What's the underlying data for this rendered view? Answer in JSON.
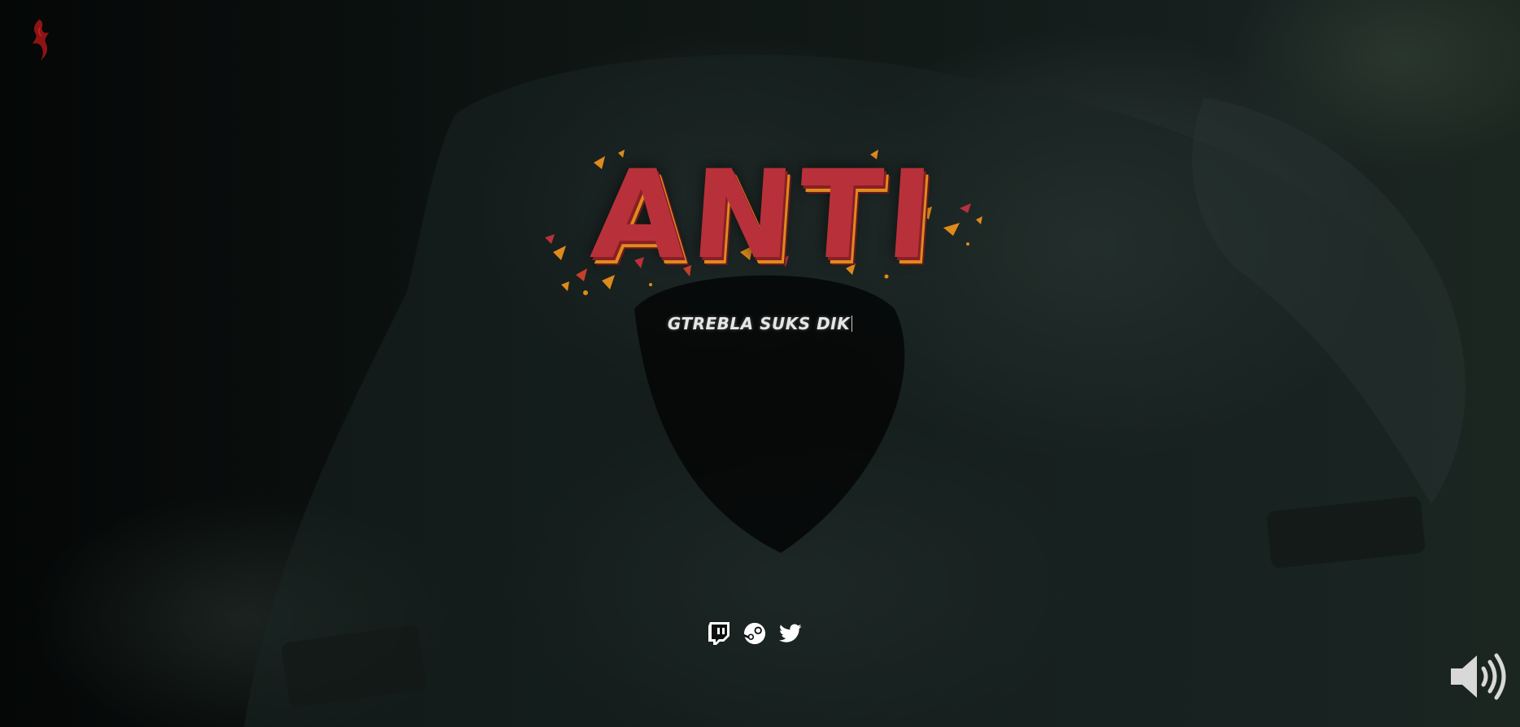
{
  "title_logo": {
    "text": "ANTI",
    "colors": {
      "primary": "#b8313a",
      "accent": "#e08a1c"
    }
  },
  "tagline": {
    "text": "GTREBLA SUKS DIK"
  },
  "socials": [
    {
      "name": "twitch",
      "icon": "twitch-icon"
    },
    {
      "name": "steam",
      "icon": "steam-icon"
    },
    {
      "name": "twitter",
      "icon": "twitter-icon"
    }
  ],
  "controls": {
    "volume_icon": "volume-up-icon"
  },
  "corner_logo": {
    "icon": "red-glyph-logo",
    "color": "#8e1414"
  }
}
